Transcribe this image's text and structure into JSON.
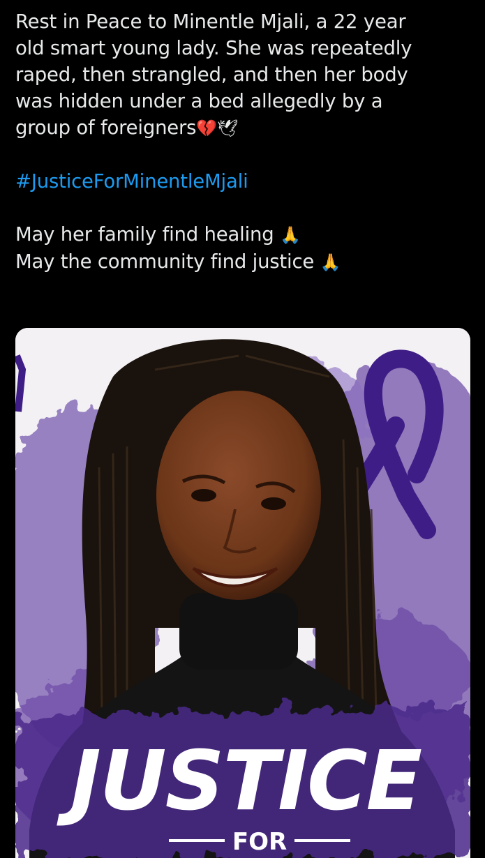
{
  "tweet": {
    "lines": [
      "Rest in Peace to Minentle Mjali, a 22 year",
      "old smart young lady. She was repeatedly",
      "raped, then strangled, and then her body",
      "was hidden under a bed allegedly by a",
      "group of foreigners"
    ],
    "line5_emojis": "💔🕊",
    "hashtag": "#JusticeForMinentleMjali",
    "prayer1": "May her family find healing",
    "prayer2": "May the community find justice",
    "prayer_emoji": "🙏"
  },
  "poster": {
    "headline": "JUSTICE",
    "subline": "FOR"
  },
  "colors": {
    "background": "#000000",
    "text": "#e7e9ea",
    "hashtag": "#1d9bf0",
    "purple": "#5a2d91"
  }
}
